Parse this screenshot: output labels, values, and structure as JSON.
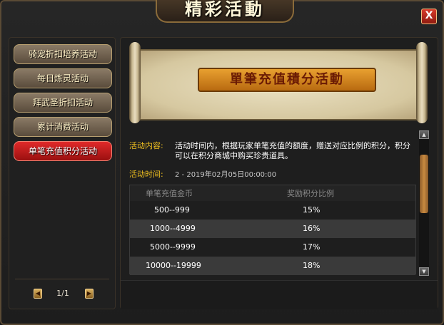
{
  "window": {
    "title": "精彩活動",
    "close_label": "X"
  },
  "sidebar": {
    "items": [
      {
        "label": "骑宠折扣培养活动",
        "active": false
      },
      {
        "label": "每日炼灵活动",
        "active": false
      },
      {
        "label": "拜武圣折扣活动",
        "active": false
      },
      {
        "label": "累计消费活动",
        "active": false
      },
      {
        "label": "单笔充值积分活动",
        "active": true
      }
    ],
    "pager": {
      "prev_icon": "◀",
      "next_icon": "▶",
      "text": "1/1"
    }
  },
  "banner": {
    "title": "單筆充值積分活動"
  },
  "content": {
    "desc_label": "活动内容:",
    "desc_text": "活动时间内，根据玩家单笔充值的额度，赠送对应比例的积分，积分可以在积分商城中购买珍贵道具。",
    "time_label": "活动时间:",
    "time_text": "2        -        2019年02月05日00:00:00"
  },
  "table": {
    "headers": [
      "单笔充值金币",
      "奖励积分比例"
    ],
    "rows": [
      [
        "500--999",
        "15%"
      ],
      [
        "1000--4999",
        "16%"
      ],
      [
        "5000--9999",
        "17%"
      ],
      [
        "10000--19999",
        "18%"
      ]
    ]
  },
  "scrollbar": {
    "up_icon": "▲",
    "down_icon": "▼"
  },
  "colors": {
    "accent_gold": "#f0c020",
    "active_red": "#c81818",
    "banner_orange": "#d8901c"
  }
}
